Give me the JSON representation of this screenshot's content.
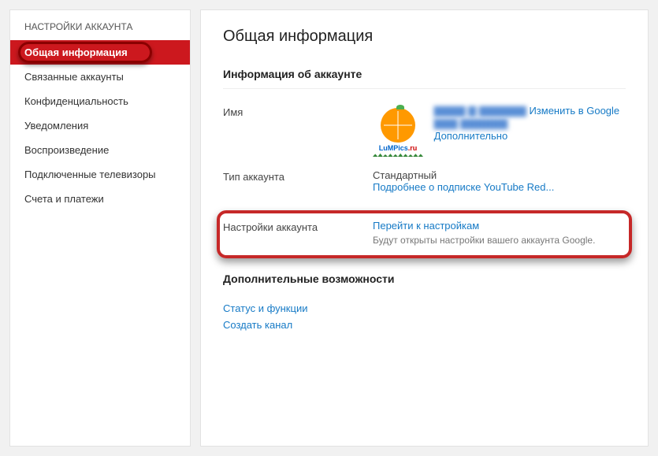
{
  "sidebar": {
    "header": "НАСТРОЙКИ АККАУНТА",
    "items": [
      {
        "label": "Общая информация",
        "active": true
      },
      {
        "label": "Связанные аккаунты"
      },
      {
        "label": "Конфиденциальность"
      },
      {
        "label": "Уведомления"
      },
      {
        "label": "Воспроизведение"
      },
      {
        "label": "Подключенные телевизоры"
      },
      {
        "label": "Счета и платежи"
      }
    ]
  },
  "main": {
    "title": "Общая информация",
    "account_info_heading": "Информация об аккаунте",
    "name_label": "Имя",
    "avatar_caption_brand": "LuMPics",
    "avatar_caption_tld": ".ru",
    "name_blurred_1": "▇▇▇▇ ▇ ▇▇▇▇▇▇",
    "name_blurred_2": "▇▇▇ ▇▇▇▇▇▇",
    "change_in_google": "Изменить в Google",
    "advanced": "Дополнительно",
    "account_type_label": "Тип аккаунта",
    "account_type_value": "Стандартный",
    "youtube_red_link": "Подробнее о подписке YouTube Red...",
    "settings_label": "Настройки аккаунта",
    "go_to_settings": "Перейти к настройкам",
    "settings_desc": "Будут открыты настройки вашего аккаунта Google.",
    "extra_heading": "Дополнительные возможности",
    "status_link": "Статус и функции",
    "create_channel_link": "Создать канал"
  }
}
